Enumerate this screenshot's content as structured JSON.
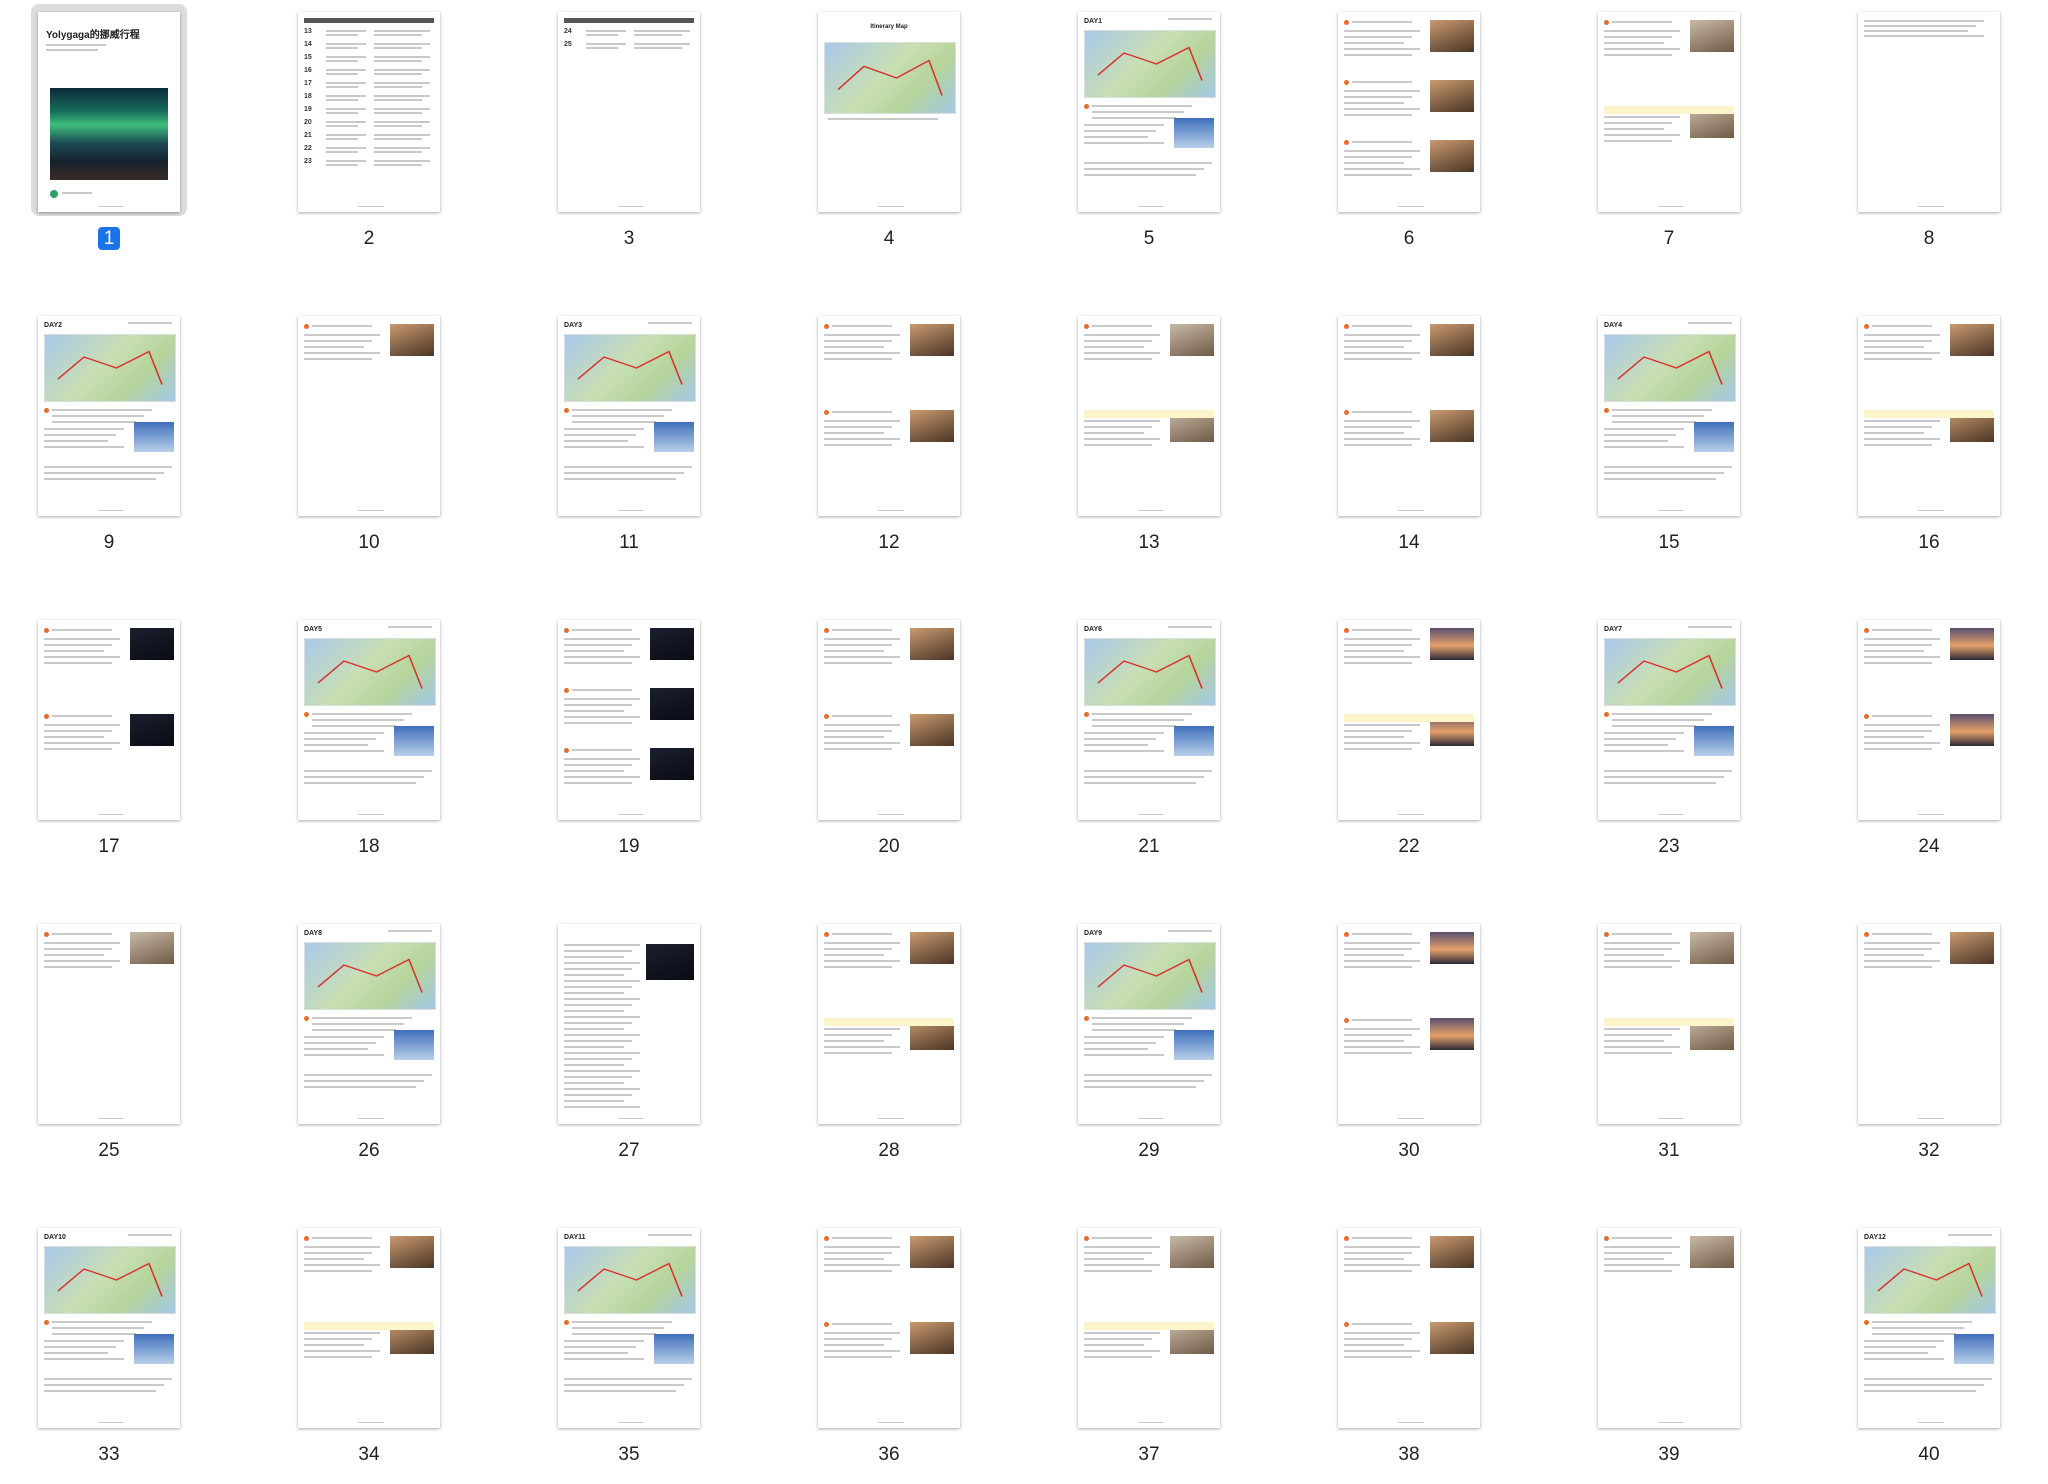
{
  "cover": {
    "title": "Yolygaga的挪威行程"
  },
  "map_page": {
    "title": "Itinerary Map"
  },
  "colors": {
    "selection": "#1a73e8",
    "route": "#d9302b",
    "accent": "#e66b2c"
  },
  "pages": [
    {
      "number": "1",
      "kind": "cover",
      "selected": true
    },
    {
      "number": "2",
      "kind": "schedule",
      "days": [
        "13",
        "14",
        "15",
        "16",
        "17",
        "18",
        "19",
        "20",
        "21",
        "22",
        "23"
      ]
    },
    {
      "number": "3",
      "kind": "schedule-short",
      "days": [
        "24",
        "25"
      ]
    },
    {
      "number": "4",
      "kind": "overview-map"
    },
    {
      "number": "5",
      "kind": "day",
      "day": "DAY1"
    },
    {
      "number": "6",
      "kind": "photos3"
    },
    {
      "number": "7",
      "kind": "photos2"
    },
    {
      "number": "8",
      "kind": "text"
    },
    {
      "number": "9",
      "kind": "day",
      "day": "DAY2"
    },
    {
      "number": "10",
      "kind": "photo1"
    },
    {
      "number": "11",
      "kind": "day",
      "day": "DAY3"
    },
    {
      "number": "12",
      "kind": "photos2"
    },
    {
      "number": "13",
      "kind": "photos2"
    },
    {
      "number": "14",
      "kind": "photos2"
    },
    {
      "number": "15",
      "kind": "day",
      "day": "DAY4"
    },
    {
      "number": "16",
      "kind": "photos2"
    },
    {
      "number": "17",
      "kind": "photos2n"
    },
    {
      "number": "18",
      "kind": "day",
      "day": "DAY5"
    },
    {
      "number": "19",
      "kind": "photos3n"
    },
    {
      "number": "20",
      "kind": "photos2"
    },
    {
      "number": "21",
      "kind": "day",
      "day": "DAY6"
    },
    {
      "number": "22",
      "kind": "photos2s"
    },
    {
      "number": "23",
      "kind": "day",
      "day": "DAY7"
    },
    {
      "number": "24",
      "kind": "photos2s"
    },
    {
      "number": "25",
      "kind": "photo1"
    },
    {
      "number": "26",
      "kind": "day",
      "day": "DAY8"
    },
    {
      "number": "27",
      "kind": "textphoto"
    },
    {
      "number": "28",
      "kind": "photos2"
    },
    {
      "number": "29",
      "kind": "day",
      "day": "DAY9"
    },
    {
      "number": "30",
      "kind": "photos2s"
    },
    {
      "number": "31",
      "kind": "photos2"
    },
    {
      "number": "32",
      "kind": "photo1"
    },
    {
      "number": "33",
      "kind": "day",
      "day": "DAY10"
    },
    {
      "number": "34",
      "kind": "photos2"
    },
    {
      "number": "35",
      "kind": "day",
      "day": "DAY11"
    },
    {
      "number": "36",
      "kind": "photos2"
    },
    {
      "number": "37",
      "kind": "photos2"
    },
    {
      "number": "38",
      "kind": "photos2"
    },
    {
      "number": "39",
      "kind": "photo1"
    },
    {
      "number": "40",
      "kind": "day",
      "day": "DAY12"
    }
  ]
}
